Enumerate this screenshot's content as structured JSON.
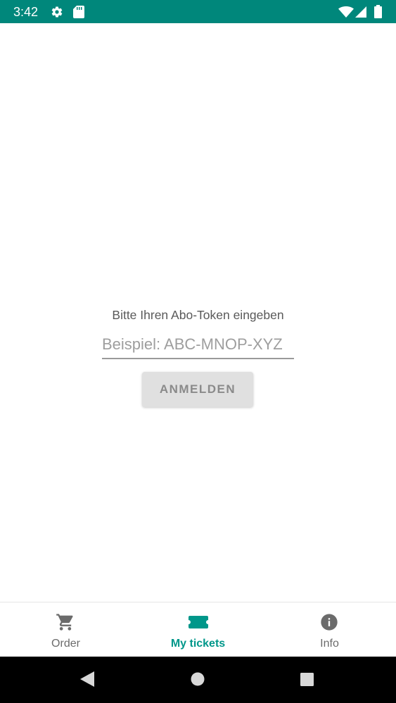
{
  "status_bar": {
    "time": "3:42",
    "background": "#00877b",
    "icons": [
      "gear-icon",
      "sd-card-icon",
      "wifi-icon",
      "signal-icon",
      "battery-icon"
    ]
  },
  "main": {
    "prompt": "Bitte Ihren Abo-Token eingeben",
    "token_input": {
      "value": "",
      "placeholder": "Beispiel: ABC-MNOP-XYZ"
    },
    "login_button": "ANMELDEN"
  },
  "bottom_nav": {
    "accent": "#00978a",
    "items": [
      {
        "label": "Order",
        "icon": "cart-icon",
        "active": false
      },
      {
        "label": "My tickets",
        "icon": "ticket-icon",
        "active": true
      },
      {
        "label": "Info",
        "icon": "info-icon",
        "active": false
      }
    ]
  },
  "system_nav": {
    "buttons": [
      "back-icon",
      "home-icon",
      "recents-icon"
    ]
  }
}
